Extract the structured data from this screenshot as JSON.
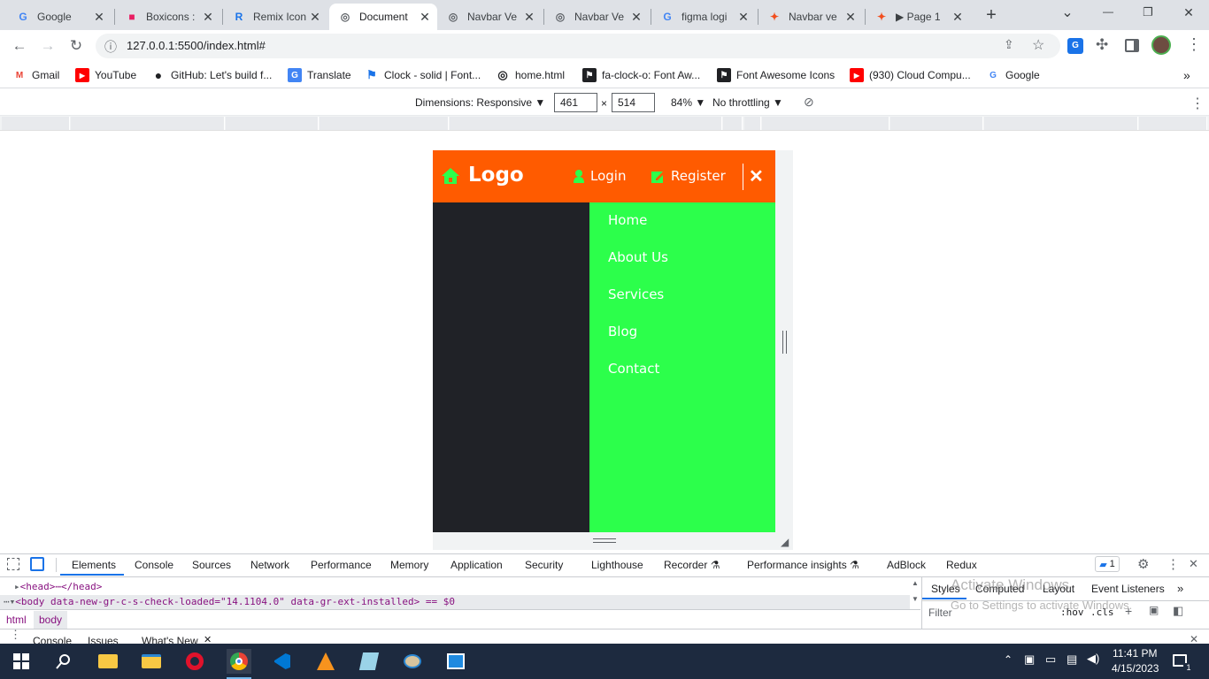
{
  "tabs": [
    {
      "title": "Google",
      "fav": "G",
      "favColor": "#4285f4",
      "active": false
    },
    {
      "title": "Boxicons :",
      "fav": "■",
      "favColor": "#e91e63",
      "active": false
    },
    {
      "title": "Remix Icon",
      "fav": "R",
      "favColor": "#1a73e8",
      "active": false
    },
    {
      "title": "Document",
      "fav": "◎",
      "favColor": "#5f6368",
      "active": true
    },
    {
      "title": "Navbar Ve",
      "fav": "◎",
      "favColor": "#5f6368",
      "active": false
    },
    {
      "title": "Navbar Ve",
      "fav": "◎",
      "favColor": "#5f6368",
      "active": false
    },
    {
      "title": "figma logi",
      "fav": "G",
      "favColor": "#4285f4",
      "active": false
    },
    {
      "title": "Navbar ve",
      "fav": "✦",
      "favColor": "#f24e1e",
      "active": false
    },
    {
      "title": "▶ Page 1",
      "fav": "✦",
      "favColor": "#f24e1e",
      "active": false
    }
  ],
  "new_tab": "+",
  "window_controls": {
    "minimize": "—",
    "restore": "❐",
    "close": "✕",
    "tabsearch": "⌄"
  },
  "address": {
    "url": "127.0.0.1:5500/index.html#",
    "info_icon": "ⓘ"
  },
  "bookmarks": [
    {
      "label": "Gmail",
      "icon": "M",
      "color": "#ea4335"
    },
    {
      "label": "YouTube",
      "icon": "▶",
      "color": "#ff0000"
    },
    {
      "label": "GitHub: Let's build f...",
      "icon": "●",
      "color": "#202124"
    },
    {
      "label": "Translate",
      "icon": "G",
      "color": "#4285f4"
    },
    {
      "label": "Clock - solid | Font...",
      "icon": "⚑",
      "color": "#1a73e8"
    },
    {
      "label": "home.html",
      "icon": "◎",
      "color": "#202124"
    },
    {
      "label": "fa-clock-o: Font Aw...",
      "icon": "⚑",
      "color": "#202124"
    },
    {
      "label": "Font Awesome Icons",
      "icon": "⚑",
      "color": "#202124"
    },
    {
      "label": "(930) Cloud Compu...",
      "icon": "▶",
      "color": "#ff0000"
    },
    {
      "label": "Google",
      "icon": "G",
      "color": "#4285f4"
    }
  ],
  "bookmarks_more": "»",
  "device_toolbar": {
    "dimensions_label": "Dimensions: Responsive ▼",
    "width": "461",
    "times": "×",
    "height": "514",
    "zoom": "84% ▼",
    "throttle": "No throttling ▼",
    "more": "⋮",
    "rotate": "⊘"
  },
  "site": {
    "logo_text": "Logo",
    "login_label": "Login",
    "register_label": "Register",
    "close_glyph": "✕",
    "menu": [
      "Home",
      "About Us",
      "Services",
      "Blog",
      "Contact"
    ],
    "colors": {
      "navbar": "#ff5b00",
      "menu": "#2cff4b",
      "page": "#202227",
      "icon": "#2cff4b"
    }
  },
  "devtools": {
    "tabs": [
      "Elements",
      "Console",
      "Sources",
      "Network",
      "Performance",
      "Memory",
      "Application",
      "Security",
      "Lighthouse",
      "Recorder ⚗",
      "Performance insights ⚗",
      "AdBlock",
      "Redux"
    ],
    "issues_badge": "1",
    "head_line": "<head>⋯</head>",
    "body_line": "<body data-new-gr-c-s-check-loaded=\"14.1104.0\" data-gr-ext-installed> == $0",
    "breadcrumbs": [
      "html",
      "body"
    ],
    "styles_tabs": [
      "Styles",
      "Computed",
      "Layout",
      "Event Listeners"
    ],
    "styles_more": "»",
    "filter_placeholder": "Filter",
    "hov": ":hov",
    "cls": ".cls",
    "drawer_tabs": [
      "Console",
      "Issues",
      "What's New"
    ],
    "watermark_line1": "Activate Windows",
    "watermark_line2": "Go to Settings to activate Windows."
  },
  "taskbar": {
    "time": "11:41 PM",
    "date": "4/15/2023",
    "notification_count": "1"
  }
}
